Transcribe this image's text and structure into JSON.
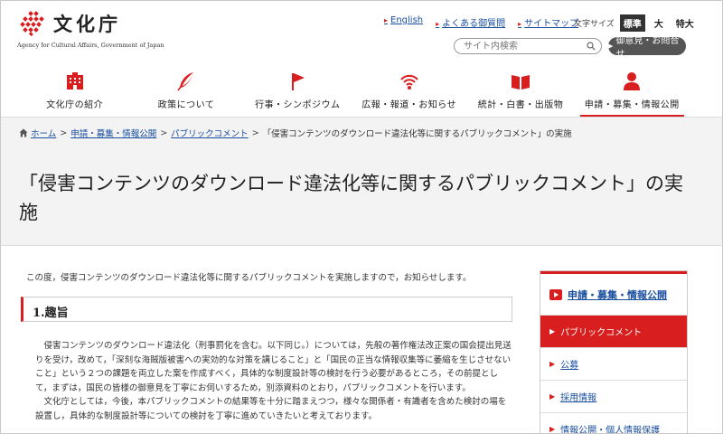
{
  "header": {
    "logo_text": "文化庁",
    "logo_sub": "Agency for Cultural Affairs, Government of Japan",
    "util_links": [
      "English",
      "よくある御質問",
      "サイトマップ"
    ],
    "fontsize_label": "文字サイズ",
    "fontsize_options": [
      "標準",
      "大",
      "特大"
    ],
    "search_placeholder": "サイト内検索",
    "contact_label": "御意見・お問合せ"
  },
  "nav": {
    "items": [
      {
        "label": "文化庁の紹介",
        "icon": "building-icon"
      },
      {
        "label": "政策について",
        "icon": "quill-icon"
      },
      {
        "label": "行事・シンポジウム",
        "icon": "flag-icon"
      },
      {
        "label": "広報・報道・お知らせ",
        "icon": "broadcast-icon"
      },
      {
        "label": "統計・白書・出版物",
        "icon": "book-icon"
      },
      {
        "label": "申請・募集・情報公開",
        "icon": "person-icon"
      }
    ],
    "active_index": 5
  },
  "breadcrumb": {
    "home": "ホーム",
    "links": [
      "申請・募集・情報公開",
      "パブリックコメント"
    ],
    "current": "「侵害コンテンツのダウンロード違法化等に関するパブリックコメント」の実施"
  },
  "page": {
    "title": "「侵害コンテンツのダウンロード違法化等に関するパブリックコメント」の実施",
    "intro": "この度，侵害コンテンツのダウンロード違法化等に関するパブリックコメントを実施しますので，お知らせします。",
    "section_heading": "1.趣旨",
    "body_p1": "　侵害コンテンツのダウンロード違法化（刑事罰化を含む。以下同じ。）については，先般の著作権法改正案の国会提出見送りを受け，改めて，「深刻な海賊版被害への実効的な対策を講じること」と「国民の正当な情報収集等に萎縮を生じさせないこと」という２つの課題を両立した案を作成すべく，具体的な制度設計等の検討を行う必要があるところ，その前提として，まずは，国民の皆様の御意見を丁寧にお伺いするため，別添資料のとおり，パブリックコメントを行います。",
    "body_p2": "　文化庁としては，今後，本パブリックコメントの結果等を十分に踏まえつつ，様々な関係者・有識者を含めた検討の場を設置し，具体的な制度設計等についての検討を丁寧に進めていきたいと考えております。"
  },
  "side": {
    "heading": "申請・募集・情報公開",
    "items": [
      "パブリックコメント",
      "公募",
      "採用情報",
      "情報公開・個人情報保護"
    ],
    "active_index": 0
  },
  "colors": {
    "accent": "#d81e1e",
    "link": "#1a4fa0",
    "band": "#f3f3f3"
  }
}
